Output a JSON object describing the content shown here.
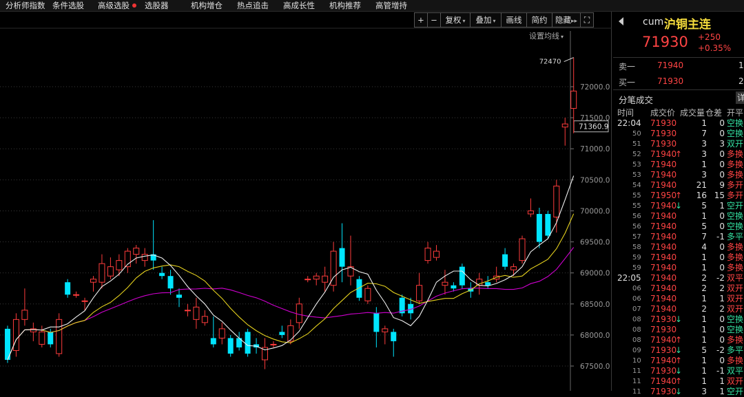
{
  "topnav": {
    "items": [
      "分析师指数",
      "条件选股",
      "高级选股",
      "选股器",
      "机构增仓",
      "热点追击",
      "高成长性",
      "机构推荐",
      "高管增持"
    ]
  },
  "toolbar": {
    "zoom_in": "+",
    "zoom_out": "−",
    "fuquan": "复权",
    "diejia": "叠加",
    "huaxian": "画线",
    "jianyue": "简约",
    "yincang": "隐藏",
    "expand": "⛶"
  },
  "chart_header": {
    "set_ma_label": "设置均线"
  },
  "chart_data": {
    "type": "candlestick",
    "y_ticks": [
      "72000.0",
      "71500.0",
      "71000.0",
      "70500.0",
      "70000.0",
      "69500.0",
      "69000.0",
      "68500.0",
      "68000.0",
      "67500.0"
    ],
    "current_price_label": "71360.9",
    "high_annotation": "72470",
    "ylim": [
      67100,
      72650
    ],
    "candles": [
      {
        "o": 68100,
        "h": 68150,
        "l": 67550,
        "c": 67600
      },
      {
        "o": 67750,
        "h": 68350,
        "l": 67650,
        "c": 68250
      },
      {
        "o": 68250,
        "h": 68750,
        "l": 68150,
        "c": 68400
      },
      {
        "o": 68050,
        "h": 68200,
        "l": 67900,
        "c": 68100
      },
      {
        "o": 67850,
        "h": 68150,
        "l": 67800,
        "c": 68050
      },
      {
        "o": 68050,
        "h": 68100,
        "l": 67800,
        "c": 67850
      },
      {
        "o": 67700,
        "h": 68350,
        "l": 67650,
        "c": 68250
      },
      {
        "o": 68850,
        "h": 68900,
        "l": 68600,
        "c": 68650
      },
      {
        "o": 68650,
        "h": 68700,
        "l": 68600,
        "c": 68650
      },
      {
        "o": 68550,
        "h": 68600,
        "l": 68400,
        "c": 68550
      },
      {
        "o": 68850,
        "h": 68950,
        "l": 68700,
        "c": 68900
      },
      {
        "o": 68850,
        "h": 69300,
        "l": 68750,
        "c": 69150
      },
      {
        "o": 68950,
        "h": 69250,
        "l": 68900,
        "c": 69100
      },
      {
        "o": 69050,
        "h": 69300,
        "l": 68950,
        "c": 69200
      },
      {
        "o": 69100,
        "h": 69400,
        "l": 69000,
        "c": 69350
      },
      {
        "o": 69300,
        "h": 69450,
        "l": 69150,
        "c": 69400
      },
      {
        "o": 69200,
        "h": 69400,
        "l": 69100,
        "c": 69300
      },
      {
        "o": 69300,
        "h": 69850,
        "l": 69050,
        "c": 69200
      },
      {
        "o": 69000,
        "h": 69100,
        "l": 68900,
        "c": 68950
      },
      {
        "o": 68950,
        "h": 69050,
        "l": 68650,
        "c": 68750
      },
      {
        "o": 68650,
        "h": 68750,
        "l": 68450,
        "c": 68600
      },
      {
        "o": 68400,
        "h": 68500,
        "l": 68300,
        "c": 68400
      },
      {
        "o": 68250,
        "h": 68600,
        "l": 68100,
        "c": 68450
      },
      {
        "o": 68200,
        "h": 68400,
        "l": 68150,
        "c": 68300
      },
      {
        "o": 67950,
        "h": 68300,
        "l": 67800,
        "c": 67850
      },
      {
        "o": 67950,
        "h": 68200,
        "l": 67850,
        "c": 68100
      },
      {
        "o": 67950,
        "h": 68000,
        "l": 67650,
        "c": 67700
      },
      {
        "o": 67950,
        "h": 68050,
        "l": 67750,
        "c": 67800
      },
      {
        "o": 68050,
        "h": 68100,
        "l": 67650,
        "c": 67700
      },
      {
        "o": 67850,
        "h": 67950,
        "l": 67700,
        "c": 67800
      },
      {
        "o": 67600,
        "h": 67950,
        "l": 67450,
        "c": 67800
      },
      {
        "o": 67850,
        "h": 67900,
        "l": 67800,
        "c": 67850
      },
      {
        "o": 68050,
        "h": 68150,
        "l": 67950,
        "c": 68000
      },
      {
        "o": 67900,
        "h": 68250,
        "l": 67850,
        "c": 68150
      },
      {
        "o": 68200,
        "h": 68600,
        "l": 68100,
        "c": 68500
      },
      {
        "o": 68900,
        "h": 68950,
        "l": 68850,
        "c": 68900
      },
      {
        "o": 68900,
        "h": 69000,
        "l": 68800,
        "c": 68950
      },
      {
        "o": 68850,
        "h": 69100,
        "l": 68700,
        "c": 68950
      },
      {
        "o": 68800,
        "h": 69500,
        "l": 68700,
        "c": 69350
      },
      {
        "o": 69400,
        "h": 69800,
        "l": 68850,
        "c": 69100
      },
      {
        "o": 68950,
        "h": 69600,
        "l": 68800,
        "c": 69100
      },
      {
        "o": 68900,
        "h": 68950,
        "l": 68550,
        "c": 68600
      },
      {
        "o": 68550,
        "h": 68800,
        "l": 68500,
        "c": 68750
      },
      {
        "o": 68350,
        "h": 68450,
        "l": 67800,
        "c": 68050
      },
      {
        "o": 68050,
        "h": 68150,
        "l": 67850,
        "c": 68100
      },
      {
        "o": 68050,
        "h": 68100,
        "l": 67650,
        "c": 67900
      },
      {
        "o": 68600,
        "h": 68650,
        "l": 68300,
        "c": 68350
      },
      {
        "o": 68500,
        "h": 68600,
        "l": 68250,
        "c": 68350
      },
      {
        "o": 68550,
        "h": 69000,
        "l": 68500,
        "c": 68800
      },
      {
        "o": 69200,
        "h": 69500,
        "l": 69150,
        "c": 69400
      },
      {
        "o": 69250,
        "h": 69450,
        "l": 69200,
        "c": 69350
      },
      {
        "o": 68800,
        "h": 69050,
        "l": 68650,
        "c": 68850
      },
      {
        "o": 68800,
        "h": 68850,
        "l": 68700,
        "c": 68750
      },
      {
        "o": 69100,
        "h": 69150,
        "l": 68750,
        "c": 68800
      },
      {
        "o": 68750,
        "h": 68850,
        "l": 68600,
        "c": 68700
      },
      {
        "o": 68800,
        "h": 69000,
        "l": 68650,
        "c": 68900
      },
      {
        "o": 68850,
        "h": 68950,
        "l": 68750,
        "c": 68800
      },
      {
        "o": 68900,
        "h": 69100,
        "l": 68850,
        "c": 68950
      },
      {
        "o": 69300,
        "h": 69400,
        "l": 69050,
        "c": 69100
      },
      {
        "o": 69050,
        "h": 69150,
        "l": 68950,
        "c": 69100
      },
      {
        "o": 69200,
        "h": 69600,
        "l": 69150,
        "c": 69550
      },
      {
        "o": 69950,
        "h": 70200,
        "l": 69900,
        "c": 70000
      },
      {
        "o": 69950,
        "h": 70050,
        "l": 69400,
        "c": 69500
      },
      {
        "o": 69950,
        "h": 70000,
        "l": 69550,
        "c": 69600
      },
      {
        "o": 69900,
        "h": 70500,
        "l": 69650,
        "c": 70400
      },
      {
        "o": 71350,
        "h": 71500,
        "l": 71050,
        "c": 71400
      },
      {
        "o": 71650,
        "h": 72470,
        "l": 71250,
        "c": 71930
      }
    ]
  },
  "quote": {
    "code": "cum",
    "name": "沪铜主连",
    "price": "71930",
    "change": "+250",
    "change_pct": "+0.35%",
    "sell1_label": "卖一",
    "sell1_price": "71940",
    "sell1_vol": "1",
    "buy1_label": "买一",
    "buy1_price": "71930",
    "buy1_vol": "2"
  },
  "trades": {
    "title": "分笔成交",
    "detail_btn": "详",
    "headers": [
      "时间",
      "成交价",
      "成交量",
      "仓差",
      "开平"
    ],
    "rows": [
      {
        "time": "22:04",
        "price": "71930",
        "arrow": "",
        "vol": "1",
        "diff": "0",
        "type": "空换",
        "tc": "green"
      },
      {
        "time": "50",
        "price": "71930",
        "arrow": "",
        "vol": "7",
        "diff": "0",
        "type": "空换",
        "tc": "green"
      },
      {
        "time": "51",
        "price": "71930",
        "arrow": "",
        "vol": "3",
        "diff": "3",
        "type": "双开",
        "tc": "green"
      },
      {
        "time": "52",
        "price": "71940",
        "arrow": "↑",
        "vol": "3",
        "diff": "0",
        "type": "多换",
        "tc": "red"
      },
      {
        "time": "53",
        "price": "71940",
        "arrow": "",
        "vol": "1",
        "diff": "0",
        "type": "多换",
        "tc": "red"
      },
      {
        "time": "53",
        "price": "71940",
        "arrow": "",
        "vol": "3",
        "diff": "0",
        "type": "多换",
        "tc": "red"
      },
      {
        "time": "54",
        "price": "71940",
        "arrow": "",
        "vol": "21",
        "diff": "9",
        "type": "多开",
        "tc": "red"
      },
      {
        "time": "55",
        "price": "71950",
        "arrow": "↑",
        "vol": "16",
        "diff": "15",
        "type": "多开",
        "tc": "red"
      },
      {
        "time": "55",
        "price": "71940",
        "arrow": "↓",
        "vol": "5",
        "diff": "1",
        "type": "空开",
        "tc": "green"
      },
      {
        "time": "56",
        "price": "71940",
        "arrow": "",
        "vol": "1",
        "diff": "0",
        "type": "空换",
        "tc": "green"
      },
      {
        "time": "56",
        "price": "71940",
        "arrow": "",
        "vol": "5",
        "diff": "0",
        "type": "空换",
        "tc": "green"
      },
      {
        "time": "57",
        "price": "71940",
        "arrow": "",
        "vol": "7",
        "diff": "-1",
        "type": "多平",
        "tc": "green"
      },
      {
        "time": "58",
        "price": "71940",
        "arrow": "",
        "vol": "4",
        "diff": "0",
        "type": "多换",
        "tc": "red"
      },
      {
        "time": "59",
        "price": "71940",
        "arrow": "",
        "vol": "1",
        "diff": "0",
        "type": "多换",
        "tc": "red"
      },
      {
        "time": "59",
        "price": "71940",
        "arrow": "",
        "vol": "1",
        "diff": "0",
        "type": "多换",
        "tc": "red"
      },
      {
        "time": "22:05",
        "price": "71940",
        "arrow": "",
        "vol": "2",
        "diff": "-2",
        "type": "双平",
        "tc": "red"
      },
      {
        "time": "06",
        "price": "71940",
        "arrow": "",
        "vol": "2",
        "diff": "2",
        "type": "双开",
        "tc": "red"
      },
      {
        "time": "06",
        "price": "71940",
        "arrow": "",
        "vol": "1",
        "diff": "1",
        "type": "双开",
        "tc": "red"
      },
      {
        "time": "07",
        "price": "71940",
        "arrow": "",
        "vol": "2",
        "diff": "2",
        "type": "双开",
        "tc": "red"
      },
      {
        "time": "08",
        "price": "71930",
        "arrow": "↓",
        "vol": "1",
        "diff": "0",
        "type": "空换",
        "tc": "green"
      },
      {
        "time": "08",
        "price": "71930",
        "arrow": "",
        "vol": "1",
        "diff": "0",
        "type": "空换",
        "tc": "green"
      },
      {
        "time": "08",
        "price": "71940",
        "arrow": "↑",
        "vol": "1",
        "diff": "0",
        "type": "多换",
        "tc": "red"
      },
      {
        "time": "09",
        "price": "71930",
        "arrow": "↓",
        "vol": "5",
        "diff": "-2",
        "type": "多平",
        "tc": "green"
      },
      {
        "time": "10",
        "price": "71940",
        "arrow": "↑",
        "vol": "1",
        "diff": "0",
        "type": "多换",
        "tc": "red"
      },
      {
        "time": "11",
        "price": "71930",
        "arrow": "↓",
        "vol": "1",
        "diff": "-1",
        "type": "双平",
        "tc": "green"
      },
      {
        "time": "11",
        "price": "71940",
        "arrow": "↑",
        "vol": "1",
        "diff": "1",
        "type": "双开",
        "tc": "red"
      },
      {
        "time": "11",
        "price": "71930",
        "arrow": "↓",
        "vol": "3",
        "diff": "1",
        "type": "空开",
        "tc": "green"
      }
    ]
  }
}
